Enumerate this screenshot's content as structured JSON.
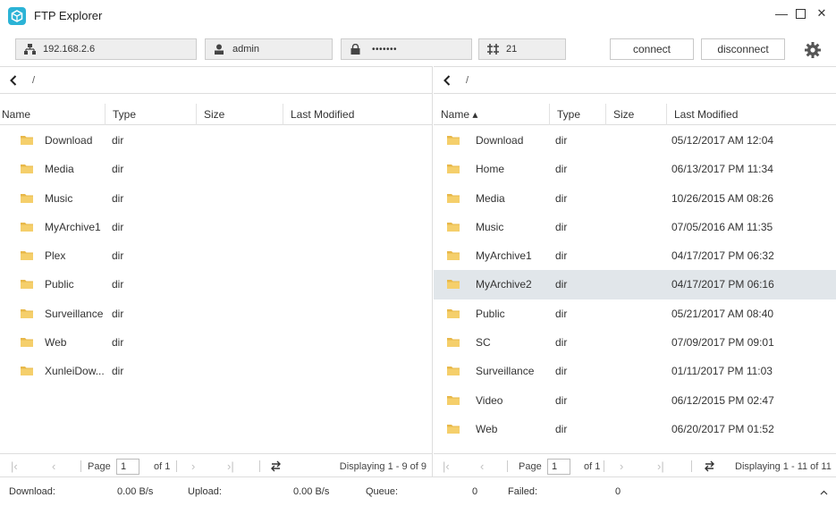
{
  "app": {
    "title": "FTP Explorer",
    "icon": "ftp-cube-icon",
    "accent": "#2bb3d6"
  },
  "window_controls": {
    "minimize": "—",
    "maximize": "☐",
    "close": "✕"
  },
  "connection": {
    "host": "192.168.2.6",
    "user": "admin",
    "password": "•••••••",
    "port": "21",
    "connect_label": "connect",
    "disconnect_label": "disconnect"
  },
  "left": {
    "path": "/",
    "columns": [
      "Name",
      "Type",
      "Size",
      "Last Modified"
    ],
    "rows": [
      {
        "name": "Download",
        "type": "dir",
        "size": "",
        "modified": ""
      },
      {
        "name": "Media",
        "type": "dir",
        "size": "",
        "modified": ""
      },
      {
        "name": "Music",
        "type": "dir",
        "size": "",
        "modified": ""
      },
      {
        "name": "MyArchive1",
        "type": "dir",
        "size": "",
        "modified": ""
      },
      {
        "name": "Plex",
        "type": "dir",
        "size": "",
        "modified": ""
      },
      {
        "name": "Public",
        "type": "dir",
        "size": "",
        "modified": ""
      },
      {
        "name": "Surveillance",
        "type": "dir",
        "size": "",
        "modified": ""
      },
      {
        "name": "Web",
        "type": "dir",
        "size": "",
        "modified": ""
      },
      {
        "name": "XunleiDow...",
        "type": "dir",
        "size": "",
        "modified": ""
      }
    ],
    "pager": {
      "page_label": "Page",
      "page": "1",
      "of": "of 1",
      "display": "Displaying 1 - 9 of 9"
    }
  },
  "right": {
    "path": "/",
    "columns": [
      "Name ▴",
      "Type",
      "Size",
      "Last Modified"
    ],
    "rows": [
      {
        "name": "Download",
        "type": "dir",
        "size": "",
        "modified": "05/12/2017 AM 12:04"
      },
      {
        "name": "Home",
        "type": "dir",
        "size": "",
        "modified": "06/13/2017 PM 11:34"
      },
      {
        "name": "Media",
        "type": "dir",
        "size": "",
        "modified": "10/26/2015 AM 08:26"
      },
      {
        "name": "Music",
        "type": "dir",
        "size": "",
        "modified": "07/05/2016 AM 11:35"
      },
      {
        "name": "MyArchive1",
        "type": "dir",
        "size": "",
        "modified": "04/17/2017 PM 06:32"
      },
      {
        "name": "MyArchive2",
        "type": "dir",
        "size": "",
        "modified": "04/17/2017 PM 06:16",
        "selected": true
      },
      {
        "name": "Public",
        "type": "dir",
        "size": "",
        "modified": "05/21/2017 AM 08:40"
      },
      {
        "name": "SC",
        "type": "dir",
        "size": "",
        "modified": "07/09/2017 PM 09:01"
      },
      {
        "name": "Surveillance",
        "type": "dir",
        "size": "",
        "modified": "01/11/2017 PM 11:03"
      },
      {
        "name": "Video",
        "type": "dir",
        "size": "",
        "modified": "06/12/2015 PM 02:47"
      },
      {
        "name": "Web",
        "type": "dir",
        "size": "",
        "modified": "06/20/2017 PM 01:52"
      }
    ],
    "pager": {
      "page_label": "Page",
      "page": "1",
      "of": "of 1",
      "display": "Displaying 1 - 11 of 11"
    }
  },
  "status": {
    "download_label": "Download:",
    "download_value": "0.00 B/s",
    "upload_label": "Upload:",
    "upload_value": "0.00 B/s",
    "queue_label": "Queue:",
    "queue_value": "0",
    "failed_label": "Failed:",
    "failed_value": "0",
    "expand": "⌃"
  },
  "colors": {
    "selected_row": "#e1e6ea",
    "folder": "#f2c55c",
    "border": "#dddddd"
  }
}
